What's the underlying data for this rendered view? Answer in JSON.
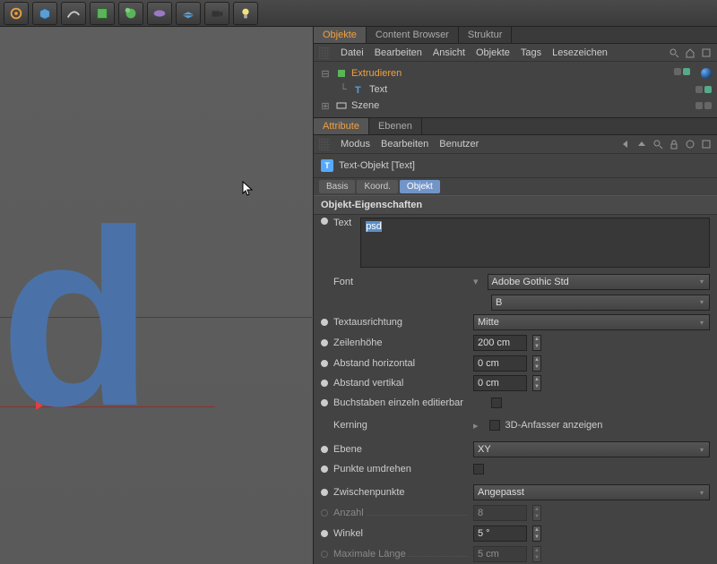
{
  "toolbar_icons": [
    "gear",
    "cube",
    "spline",
    "primitive",
    "generator",
    "deformer",
    "floor",
    "camera",
    "light"
  ],
  "panel_tabs": {
    "objects": "Objekte",
    "content_browser": "Content Browser",
    "struktur": "Struktur"
  },
  "obj_menu": {
    "datei": "Datei",
    "bearbeiten": "Bearbeiten",
    "ansicht": "Ansicht",
    "objekte": "Objekte",
    "tags": "Tags",
    "lesezeichen": "Lesezeichen"
  },
  "hierarchy": {
    "extrude": "Extrudieren",
    "text": "Text",
    "scene": "Szene"
  },
  "attr_tabs": {
    "attribute": "Attribute",
    "ebenen": "Ebenen"
  },
  "attr_menu": {
    "modus": "Modus",
    "bearbeiten": "Bearbeiten",
    "benutzer": "Benutzer"
  },
  "attr_title": "Text-Objekt [Text]",
  "sub_tabs": {
    "basis": "Basis",
    "koord": "Koord.",
    "objekt": "Objekt"
  },
  "section": {
    "props": "Objekt-Eigenschaften"
  },
  "props": {
    "text_label": "Text",
    "text_value": "psd",
    "font_label": "Font",
    "font_value": "Adobe Gothic Std",
    "font_weight": "B",
    "align_label": "Textausrichtung",
    "align_value": "Mitte",
    "lineheight_label": "Zeilenhöhe",
    "lineheight_value": "200 cm",
    "hspacing_label": "Abstand horizontal",
    "hspacing_value": "0 cm",
    "vspacing_label": "Abstand vertikal",
    "vspacing_value": "0 cm",
    "editable_label": "Buchstaben einzeln editierbar",
    "kerning_label": "Kerning",
    "kerning_check_label": "3D-Anfasser anzeigen",
    "plane_label": "Ebene",
    "plane_value": "XY",
    "reverse_label": "Punkte umdrehen",
    "interp_label": "Zwischenpunkte",
    "interp_value": "Angepasst",
    "count_label": "Anzahl",
    "count_value": "8",
    "angle_label": "Winkel",
    "angle_value": "5 °",
    "maxlen_label": "Maximale Länge",
    "maxlen_value": "5 cm"
  },
  "viewport": {
    "letter": "d"
  }
}
